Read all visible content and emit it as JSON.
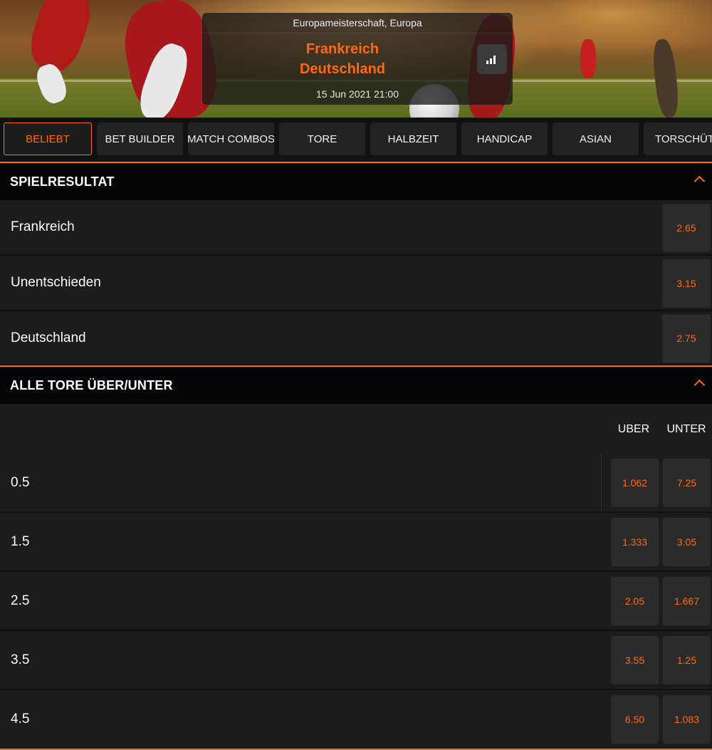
{
  "event": {
    "competition": "Europameisterschaft, Europa",
    "home_team": "Frankreich",
    "away_team": "Deutschland",
    "datetime": "15 Jun 2021 21:00",
    "stats_icon": "bar-chart-icon"
  },
  "tabs": [
    {
      "label": "BELIEBT",
      "active": true
    },
    {
      "label": "BET BUILDER",
      "active": false
    },
    {
      "label": "MATCH COMBOS",
      "active": false
    },
    {
      "label": "TORE",
      "active": false
    },
    {
      "label": "HALBZEIT",
      "active": false
    },
    {
      "label": "HANDICAP",
      "active": false
    },
    {
      "label": "ASIAN",
      "active": false
    },
    {
      "label": "TORSCHÜTZ",
      "active": false
    }
  ],
  "spielresultat": {
    "title": "SPIELRESULTAT",
    "collapse_icon": "chevron-up-icon",
    "outcomes": [
      {
        "label": "Frankreich",
        "odds": "2.65"
      },
      {
        "label": "Unentschieden",
        "odds": "3.15"
      },
      {
        "label": "Deutschland",
        "odds": "2.75"
      }
    ]
  },
  "over_under": {
    "title": "ALLE TORE ÜBER/UNTER",
    "collapse_icon": "chevron-up-icon",
    "col_over": "UBER",
    "col_under": "UNTER",
    "lines": [
      {
        "line": "0.5",
        "over": "1.062",
        "under": "7.25"
      },
      {
        "line": "1.5",
        "over": "1.333",
        "under": "3.05"
      },
      {
        "line": "2.5",
        "over": "2.05",
        "under": "1.667"
      },
      {
        "line": "3.5",
        "over": "3.55",
        "under": "1.25"
      },
      {
        "line": "4.5",
        "over": "6.50",
        "under": "1.083"
      }
    ]
  },
  "colors": {
    "accent": "#ff6a10",
    "background": "#1c1c1c",
    "odds_button": "#2b2b2b"
  }
}
